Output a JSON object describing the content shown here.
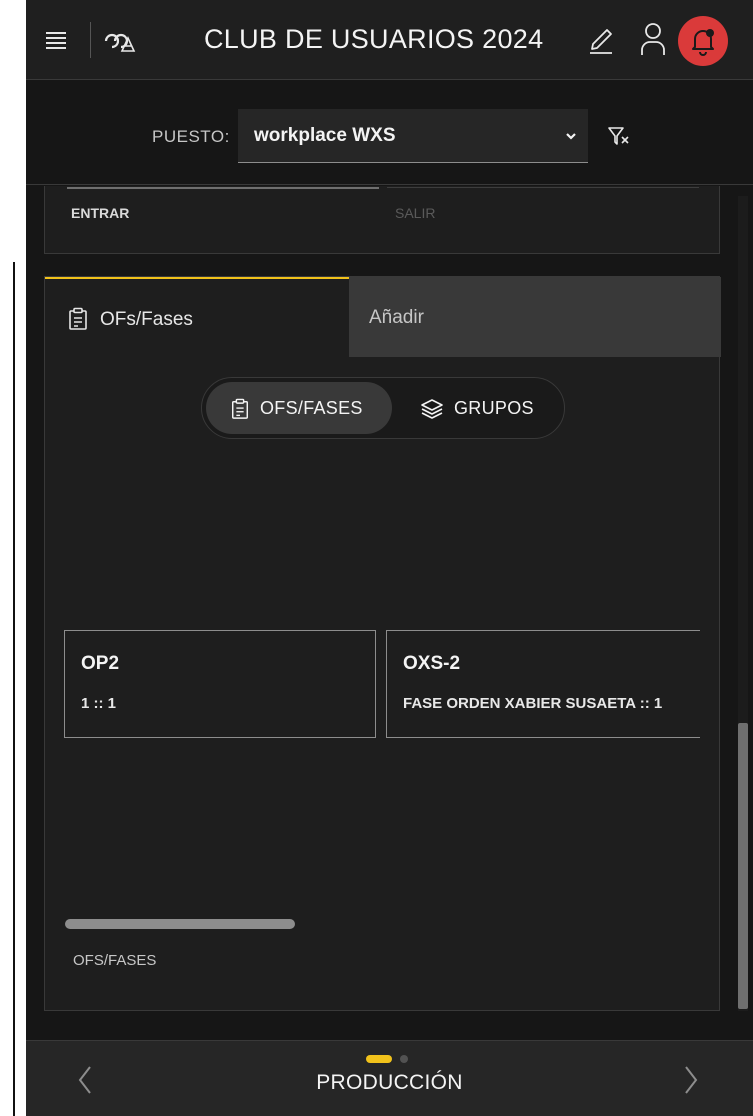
{
  "header": {
    "title": "CLUB DE USUARIOS 2024",
    "menu_icon": "hamburger-icon",
    "logo_icon": "tech-logo-icon",
    "edit_icon": "pencil-icon",
    "user_icon": "user-icon",
    "notification_icon": "bell-icon",
    "notification_color": "#da3a3a"
  },
  "workplace": {
    "label": "PUESTO:",
    "selected": "workplace WXS",
    "filter_icon": "filter-clear-icon"
  },
  "inout": {
    "enter_label": "ENTRAR",
    "exit_label": "SALIR"
  },
  "panel": {
    "tabs": [
      {
        "label": "OFs/Fases",
        "icon": "clipboard-icon",
        "active": true
      },
      {
        "label": "Añadir",
        "active": false
      }
    ],
    "expand_icon": "maximize-icon",
    "accent": "#f1c21b",
    "switcher": [
      {
        "label": "OFS/FASES",
        "icon": "clipboard-icon",
        "selected": true
      },
      {
        "label": "GRUPOS",
        "icon": "layers-icon",
        "selected": false
      }
    ],
    "cards": [
      {
        "code": "OP2",
        "detail": "1 :: 1"
      },
      {
        "code": "OXS-2",
        "detail": "FASE ORDEN XABIER SUSAETA :: 1"
      }
    ],
    "footer_label": "OFS/FASES"
  },
  "footer": {
    "title": "PRODUCCIÓN",
    "prev_icon": "chevron-left-icon",
    "next_icon": "chevron-right-icon",
    "pages": 2,
    "current_page": 1
  }
}
